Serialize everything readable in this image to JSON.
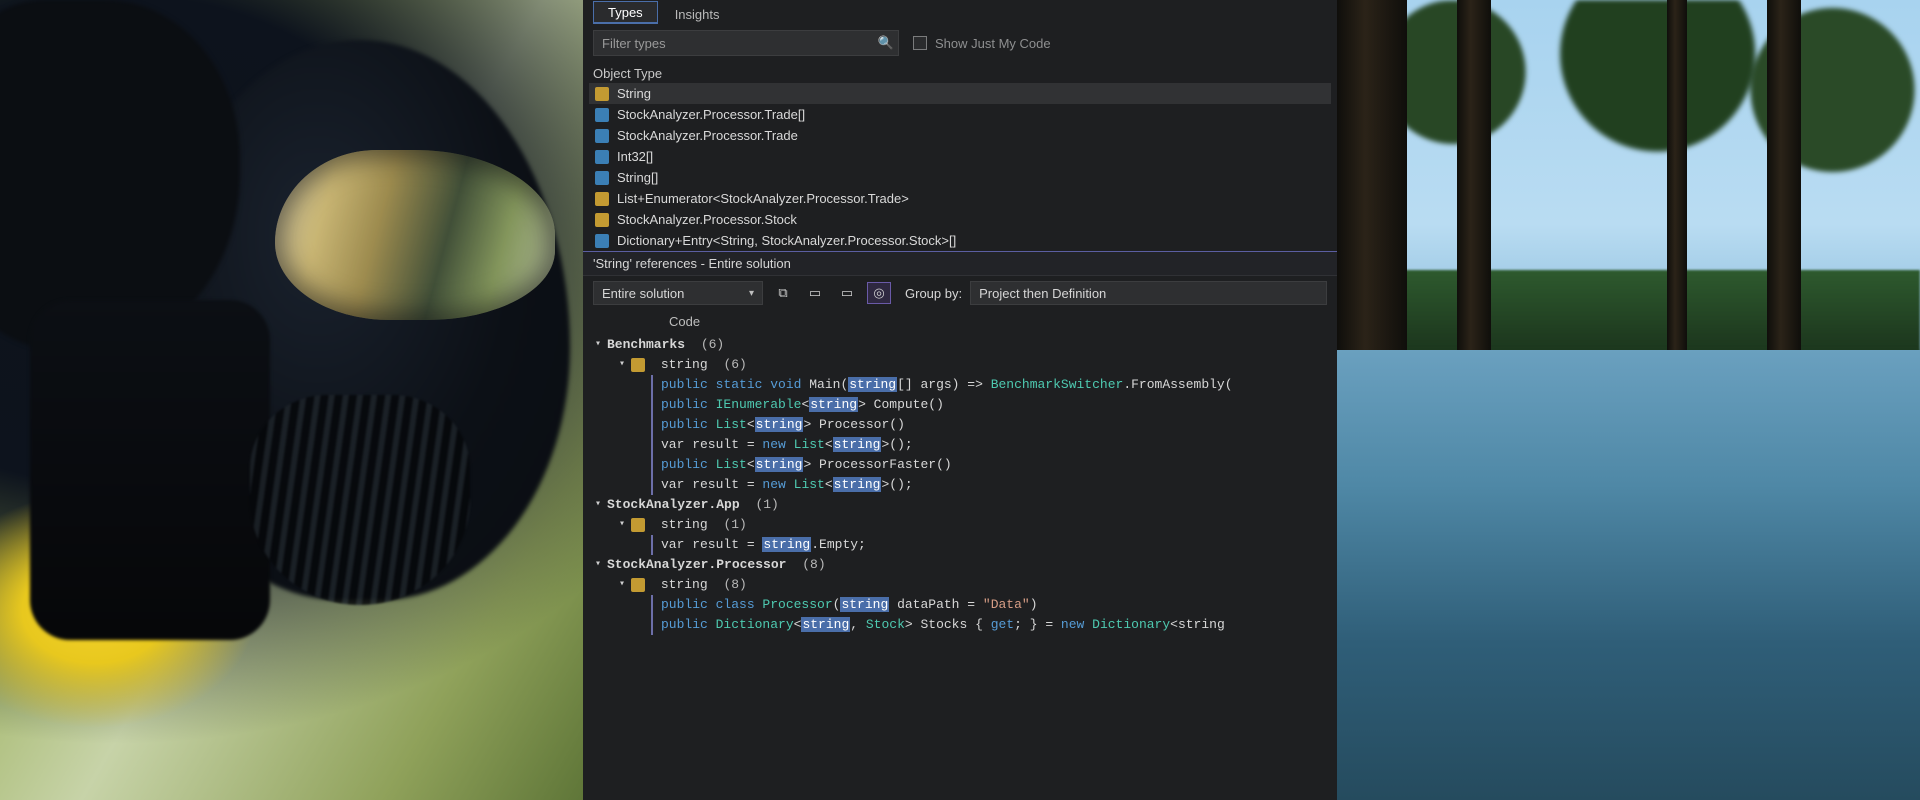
{
  "tabs": {
    "types": "Types",
    "insights": "Insights"
  },
  "filter": {
    "placeholder": "Filter types"
  },
  "show_my_code_label": "Show Just My Code",
  "object_type_header": "Object Type",
  "types": [
    "String",
    "StockAnalyzer.Processor.Trade[]",
    "StockAnalyzer.Processor.Trade",
    "Int32[]",
    "String[]",
    "List+Enumerator<StockAnalyzer.Processor.Trade>",
    "StockAnalyzer.Processor.Stock",
    "Dictionary+Entry<String, StockAnalyzer.Processor.Stock>[]"
  ],
  "refs_title": "'String' references - Entire solution",
  "scope_label": "Entire solution",
  "group_by_label": "Group by:",
  "group_by_value": "Project then Definition",
  "code_col": "Code",
  "groups": {
    "g1": {
      "name": "Benchmarks",
      "count": "(6)"
    },
    "g1s": {
      "name": "string",
      "count": "(6)"
    },
    "g2": {
      "name": "StockAnalyzer.App",
      "count": "(1)"
    },
    "g2s": {
      "name": "string",
      "count": "(1)"
    },
    "g3": {
      "name": "StockAnalyzer.Processor",
      "count": "(8)"
    },
    "g3s": {
      "name": "string",
      "count": "(8)"
    }
  },
  "code": {
    "l1a": "public static void ",
    "l1b": "Main(",
    "l1c": "string",
    "l1d": "[] args) => ",
    "l1e": "BenchmarkSwitcher",
    "l1f": ".FromAssembly(",
    "l2a": "public ",
    "l2b": "IEnumerable",
    "l2c": "<",
    "l2d": "string",
    "l2e": "> Compute()",
    "l3a": "public ",
    "l3b": "List",
    "l3c": "<",
    "l3d": "string",
    "l3e": "> Processor()",
    "l4a": "var result = ",
    "l4b": "new ",
    "l4c": "List",
    "l4d": "<",
    "l4e": "string",
    "l4f": ">();",
    "l5a": "public ",
    "l5b": "List",
    "l5c": "<",
    "l5d": "string",
    "l5e": "> ProcessorFaster()",
    "l6a": "var result = ",
    "l6b": "new ",
    "l6c": "List",
    "l6d": "<",
    "l6e": "string",
    "l6f": ">();",
    "l7a": "var result = ",
    "l7b": "string",
    "l7c": ".Empty;",
    "l8a": "public class ",
    "l8b": "Processor",
    "l8c": "(",
    "l8d": "string",
    "l8e": " dataPath = ",
    "l8f": "\"Data\"",
    "l8g": ")",
    "l9a": "public ",
    "l9b": "Dictionary",
    "l9c": "<",
    "l9d": "string",
    "l9e": ", ",
    "l9f": "Stock",
    "l9g": "> Stocks { ",
    "l9h": "get",
    "l9i": "; } = ",
    "l9j": "new ",
    "l9k": "Dictionary",
    "l9l": "<string"
  }
}
